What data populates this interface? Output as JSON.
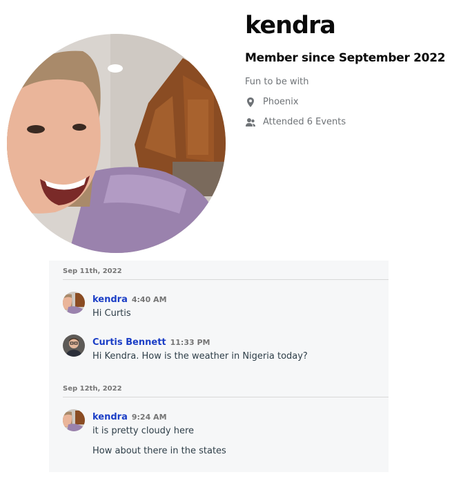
{
  "profile": {
    "name": "kendra",
    "member_since": "Member since September 2022",
    "bio": "Fun to be with",
    "location": "Phoenix",
    "events": "Attended 6 Events",
    "location_icon": "map-pin-icon",
    "events_icon": "people-icon"
  },
  "chat": {
    "groups": [
      {
        "date": "Sep 11th, 2022",
        "messages": [
          {
            "sender": "kendra",
            "time": "4:40 AM",
            "lines": [
              "Hi Curtis"
            ]
          },
          {
            "sender": "Curtis Bennett",
            "time": "11:33 PM",
            "lines": [
              "Hi Kendra. How is the weather in Nigeria today?"
            ]
          }
        ]
      },
      {
        "date": "Sep 12th, 2022",
        "messages": [
          {
            "sender": "kendra",
            "time": "9:24 AM",
            "lines": [
              "it is pretty cloudy here",
              "How about there in the states"
            ]
          }
        ]
      }
    ]
  },
  "colors": {
    "sender_link": "#1b3ec6",
    "panel_bg": "#f6f7f8",
    "muted_text": "#6f7377"
  }
}
